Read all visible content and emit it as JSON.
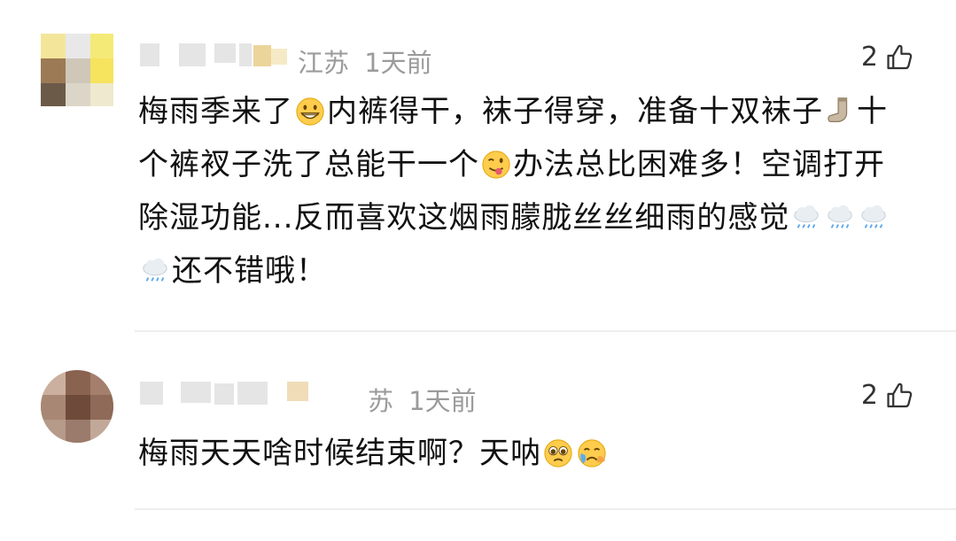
{
  "comments": [
    {
      "location": "江苏",
      "time": "1天前",
      "likes": "2",
      "text_parts": [
        "梅雨季来了",
        "内裤得干，袜子得穿，准备十双袜子",
        "十个裤衩子洗了总能干一个",
        "办法总比困难多！空调打开除湿功能...反而喜欢这烟雨朦胧丝丝细雨的感觉",
        "还不错哦！"
      ],
      "emojis": [
        "grinning-face",
        "sock",
        "winking-tongue-face",
        "rain-cloud",
        "rain-cloud",
        "rain-cloud",
        "rain-cloud"
      ]
    },
    {
      "location": "苏",
      "time": "1天前",
      "likes": "2",
      "text_parts": [
        "梅雨天天啥时候结束啊？天呐"
      ],
      "emojis": [
        "pleading-face",
        "crying-face"
      ]
    }
  ],
  "colors": {
    "meta": "#9b9b9b",
    "text": "#111111",
    "divider": "#eeeeee"
  },
  "icons": {
    "like": "thumbs-up-icon"
  }
}
